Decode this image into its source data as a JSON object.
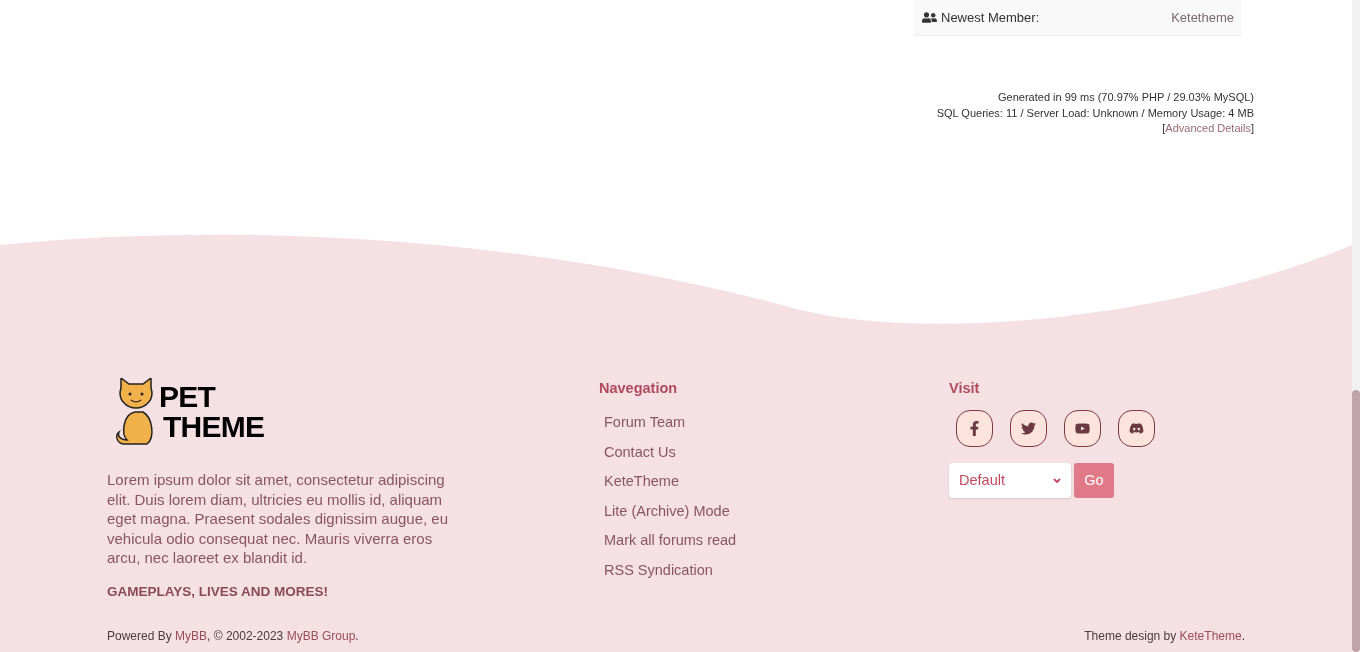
{
  "stats": {
    "label": "Newest Member:",
    "value": "Ketetheme"
  },
  "debug": {
    "line1": "Generated in 99 ms (70.97% PHP / 29.03% MySQL)",
    "line2": "SQL Queries: 11 / Server Load: Unknown / Memory Usage: 4 MB",
    "open": "[",
    "link": "Advanced Details",
    "close": "]"
  },
  "brand": {
    "line1": "PET",
    "line2": "THEME"
  },
  "about": "Lorem ipsum dolor sit amet, consectetur adipiscing elit. Duis lorem diam, ultricies eu mollis id, aliquam eget magna. Praesent sodales dignissim augue, eu vehicula odio consequat nec. Mauris viverra eros arcu, nec laoreet ex blandit id.",
  "tagline": "GAMEPLAYS, LIVES AND MORES!",
  "navigation": {
    "title": "Navegation",
    "links": [
      "Forum Team",
      "Contact Us",
      "KeteTheme",
      "Lite (Archive) Mode",
      "Mark all forums read",
      "RSS Syndication"
    ]
  },
  "visit": {
    "title": "Visit",
    "socials": [
      {
        "kind": "facebook"
      },
      {
        "kind": "twitter"
      },
      {
        "kind": "youtube"
      },
      {
        "kind": "discord"
      }
    ],
    "theme_select": {
      "value": "Default"
    },
    "go_button": "Go"
  },
  "copyright": [
    {
      "text": "Powered By ",
      "link": false
    },
    {
      "text": "MyBB",
      "link": true
    },
    {
      "text": ", © 2002-2023 ",
      "link": false
    },
    {
      "text": "MyBB Group",
      "link": true
    },
    {
      "text": ".",
      "link": false
    }
  ],
  "credit": [
    {
      "text": "Theme design by ",
      "link": false
    },
    {
      "text": "KeteTheme",
      "link": true
    },
    {
      "text": ".",
      "link": false
    }
  ]
}
